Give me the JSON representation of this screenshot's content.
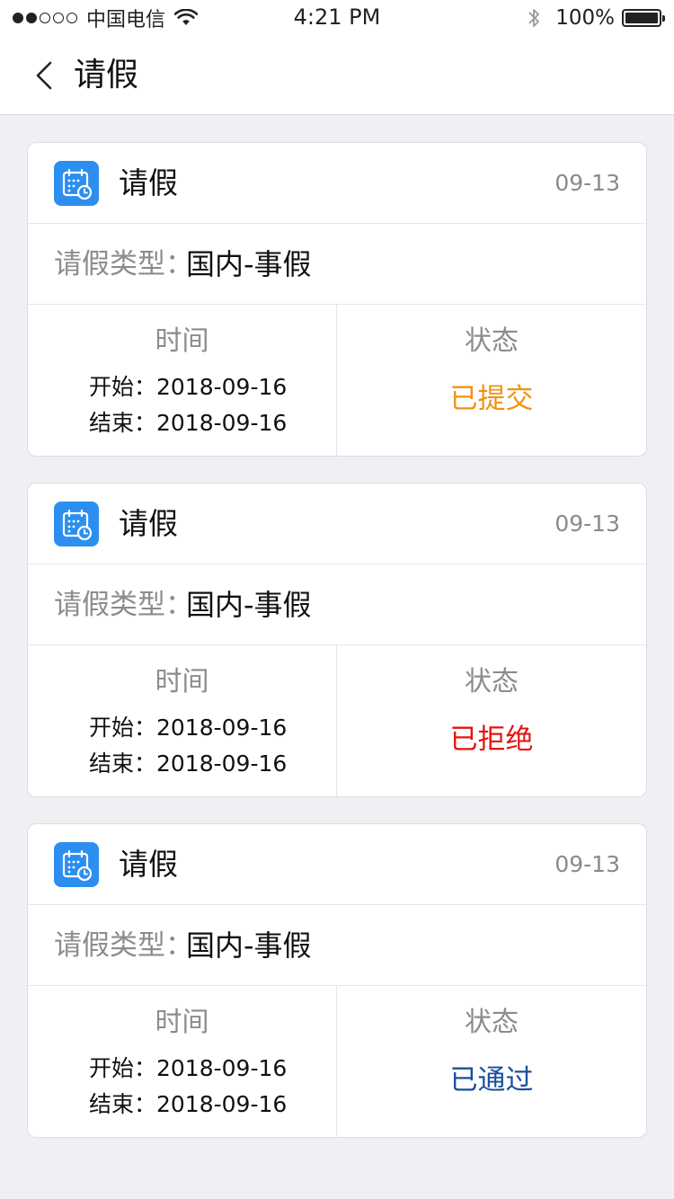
{
  "status_bar": {
    "carrier": "中国电信",
    "time": "4:21 PM",
    "battery": "100%"
  },
  "nav": {
    "title": "请假"
  },
  "cards": [
    {
      "title": "请假",
      "date": "09-13",
      "type_label": "请假类型：",
      "type_value": "国内-事假",
      "time_header": "时间",
      "start": "开始：2018-09-16",
      "end": "结束：2018-09-16",
      "status_header": "状态",
      "status": "已提交",
      "status_color": "#f0920e"
    },
    {
      "title": "请假",
      "date": "09-13",
      "type_label": "请假类型：",
      "type_value": "国内-事假",
      "time_header": "时间",
      "start": "开始：2018-09-16",
      "end": "结束：2018-09-16",
      "status_header": "状态",
      "status": "已拒绝",
      "status_color": "#e6120f"
    },
    {
      "title": "请假",
      "date": "09-13",
      "type_label": "请假类型：",
      "type_value": "国内-事假",
      "time_header": "时间",
      "start": "开始：2018-09-16",
      "end": "结束：2018-09-16",
      "status_header": "状态",
      "status": "已通过",
      "status_color": "#1a4f9c"
    }
  ],
  "theme": {
    "accent": "#2c8ff0",
    "background": "#eef0f4"
  },
  "icons": {
    "back": "chevron-left-icon",
    "app": "calendar-clock-icon",
    "wifi": "wifi-icon",
    "bluetooth": "bluetooth-icon",
    "battery": "battery-icon"
  }
}
